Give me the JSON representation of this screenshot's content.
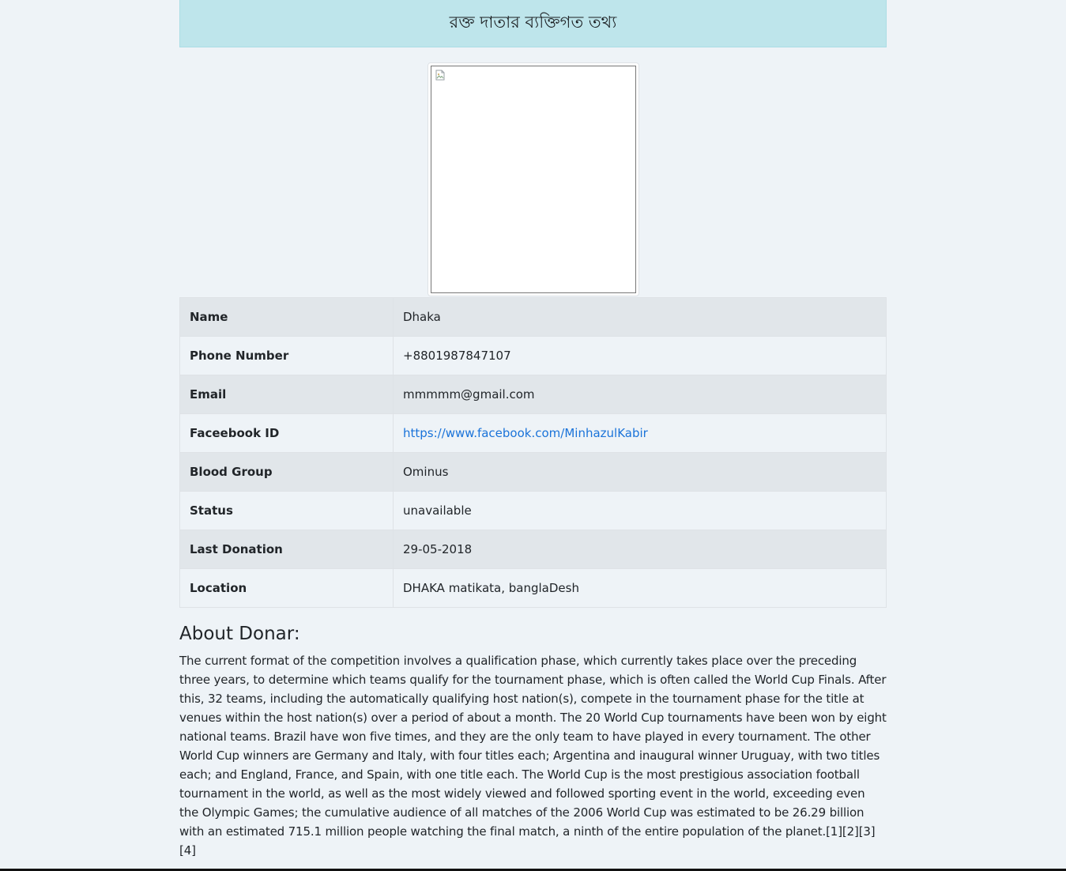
{
  "header": {
    "title": "রক্ত দাতার ব্যক্তিগত তথ্য"
  },
  "photo": {
    "icon": "broken-image-icon"
  },
  "details": [
    {
      "label": "Name",
      "value": "Dhaka"
    },
    {
      "label": "Phone Number",
      "value": "+8801987847107"
    },
    {
      "label": "Email",
      "value": "mmmmm@gmail.com"
    },
    {
      "label": "Faceebook ID",
      "value": "https://www.facebook.com/MinhazulKabir",
      "is_link": true
    },
    {
      "label": "Blood Group",
      "value": "Ominus"
    },
    {
      "label": "Status",
      "value": "unavailable"
    },
    {
      "label": "Last Donation",
      "value": "29-05-2018"
    },
    {
      "label": "Location",
      "value": "DHAKA matikata, banglaDesh"
    }
  ],
  "about": {
    "title": "About Donar:",
    "text": "The current format of the competition involves a qualification phase, which currently takes place over the preceding three years, to determine which teams qualify for the tournament phase, which is often called the World Cup Finals. After this, 32 teams, including the automatically qualifying host nation(s), compete in the tournament phase for the title at venues within the host nation(s) over a period of about a month. The 20 World Cup tournaments have been won by eight national teams. Brazil have won five times, and they are the only team to have played in every tournament. The other World Cup winners are Germany and Italy, with four titles each; Argentina and inaugural winner Uruguay, with two titles each; and England, France, and Spain, with one title each. The World Cup is the most prestigious association football tournament in the world, as well as the most widely viewed and followed sporting event in the world, exceeding even the Olympic Games; the cumulative audience of all matches of the 2006 World Cup was estimated to be 26.29 billion with an estimated 715.1 million people watching the final match, a ninth of the entire population of the planet.[1][2][3][4]"
  },
  "colors": {
    "header_bg": "#bee5eb",
    "page_bg": "#eef3f7",
    "row_striped": "#e1e6ea",
    "link": "#1a73d9"
  }
}
